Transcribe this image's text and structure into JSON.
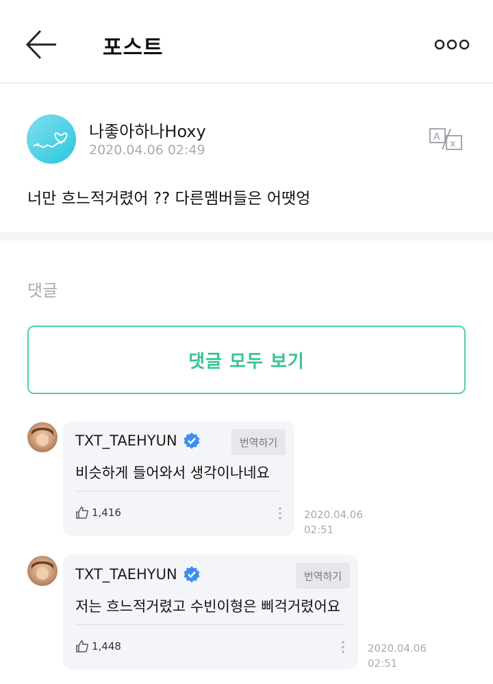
{
  "header": {
    "title": "포스트",
    "back_icon": "arrow-left-icon",
    "more_icon": "more-horizontal-icon"
  },
  "post": {
    "author": "나좋아하나Hoxy",
    "date": "2020.04.06 02:49",
    "body": "너만 흐느적거렸어 ?? 다른멤버들은 어땟엉",
    "translate_icon": "translate-icon"
  },
  "comments_section": {
    "label": "댓글",
    "view_all_label": "댓글 모두 보기",
    "items": [
      {
        "author": "TXT_TAEHYUN",
        "translate_label": "번역하기",
        "text": "비슷하게 들어와서 생각이나네요",
        "likes": "1,416",
        "date": "2020.04.06",
        "time": "02:51"
      },
      {
        "author": "TXT_TAEHYUN",
        "translate_label": "번역하기",
        "text": "저는 흐느적거렸고 수빈이형은 삐걱거렸어요",
        "likes": "1,448",
        "date": "2020.04.06",
        "time": "02:51"
      }
    ]
  },
  "colors": {
    "accent_green": "#36c296",
    "verified_blue": "#3d8ef0",
    "muted_text": "#a9a9b2",
    "bubble_bg": "#f4f5f8"
  }
}
